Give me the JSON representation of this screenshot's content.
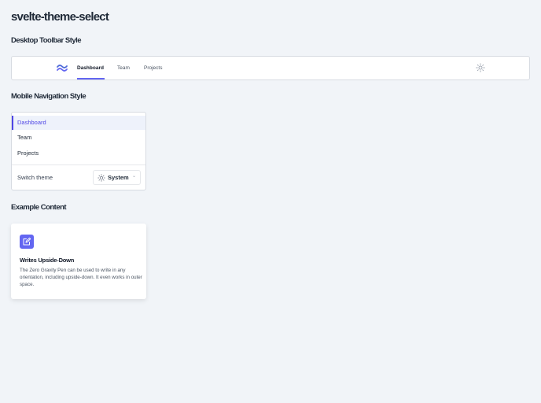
{
  "page_title": "svelte-theme-select",
  "sections": {
    "desktop": "Desktop Toolbar Style",
    "mobile": "Mobile Navigation Style",
    "example": "Example Content"
  },
  "toolbar": {
    "logo_icon": "tailwind-wave-icon",
    "nav": [
      {
        "label": "Dashboard",
        "active": true
      },
      {
        "label": "Team",
        "active": false
      },
      {
        "label": "Projects",
        "active": false
      }
    ],
    "theme_icon": "sun-icon"
  },
  "mobile_nav": {
    "items": [
      {
        "label": "Dashboard",
        "active": true
      },
      {
        "label": "Team",
        "active": false
      },
      {
        "label": "Projects",
        "active": false
      }
    ],
    "switch_label": "Switch theme",
    "theme_select": {
      "icon": "sun-icon",
      "value": "System",
      "chevron": "chevron-down-icon"
    }
  },
  "card": {
    "icon": "edit-icon",
    "title": "Writes Upside-Down",
    "body": "The Zero Gravity Pen can be used to write in any orientation, including upside-down. It even works in outer space."
  },
  "colors": {
    "accent": "#6366f1",
    "background": "#f1f4f8"
  }
}
